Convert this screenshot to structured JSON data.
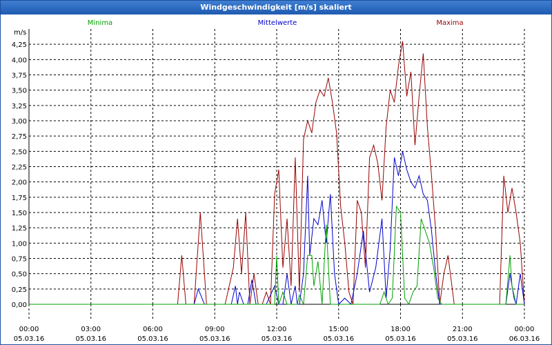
{
  "window": {
    "title": "Windgeschwindigkeit [m/s] skaliert"
  },
  "chart_data": {
    "type": "line",
    "title": "Windgeschwindigkeit [m/s] skaliert",
    "ylabel": "m/s",
    "xlabel": "",
    "ylim": [
      0,
      4.5
    ],
    "xlim": [
      0,
      24
    ],
    "grid": true,
    "legend_placement": "top",
    "y_ticks": [
      0,
      0.25,
      0.5,
      0.75,
      1.0,
      1.25,
      1.5,
      1.75,
      2.0,
      2.25,
      2.5,
      2.75,
      3.0,
      3.25,
      3.5,
      3.75,
      4.0,
      4.25
    ],
    "y_tick_labels": [
      "0,00",
      "0,25",
      "0,50",
      "0,75",
      "1,00",
      "1,25",
      "1,50",
      "1,75",
      "2,00",
      "2,25",
      "2,50",
      "2,75",
      "3,00",
      "3,25",
      "3,50",
      "3,75",
      "4,00",
      "4,25"
    ],
    "x_ticks": [
      {
        "time": "00:00",
        "date": "05.03.16"
      },
      {
        "time": "03:00",
        "date": "05.03.16"
      },
      {
        "time": "06:00",
        "date": "05.03.16"
      },
      {
        "time": "09:00",
        "date": "05.03.16"
      },
      {
        "time": "12:00",
        "date": "05.03.16"
      },
      {
        "time": "15:00",
        "date": "05.03.16"
      },
      {
        "time": "18:00",
        "date": "05.03.16"
      },
      {
        "time": "21:00",
        "date": "05.03.16"
      },
      {
        "time": "00:00",
        "date": "06.03.16"
      }
    ],
    "series": [
      {
        "name": "Minima",
        "color": "#00a000",
        "x": [
          0,
          11.9,
          12.0,
          12.1,
          12.3,
          12.5,
          12.7,
          13.0,
          13.1,
          13.3,
          13.5,
          13.7,
          13.8,
          14.0,
          14.2,
          14.4,
          14.6,
          14.8,
          15.0,
          15.5,
          16.0,
          16.5,
          17.0,
          17.2,
          17.4,
          17.6,
          17.8,
          18.0,
          18.2,
          18.4,
          18.6,
          18.8,
          19.0,
          19.2,
          19.4,
          19.6,
          19.8,
          20.0,
          23.1,
          23.3,
          23.4,
          23.6,
          23.8,
          24.0
        ],
        "y": [
          0,
          0,
          0.8,
          0,
          0.2,
          0,
          0,
          0,
          0.15,
          0,
          0.8,
          0.8,
          0.3,
          0.7,
          0,
          1.3,
          0,
          0,
          0,
          0,
          0,
          0,
          0,
          0.2,
          0,
          0.1,
          1.6,
          1.5,
          0.1,
          0,
          0.2,
          0.3,
          1.4,
          1.2,
          1.0,
          0.6,
          0.1,
          0,
          0,
          0.8,
          0.3,
          0,
          0,
          0
        ]
      },
      {
        "name": "Mittelwerte",
        "color": "#0000cc",
        "x": [
          0,
          7.5,
          7.6,
          7.8,
          8.0,
          8.2,
          8.5,
          9.6,
          9.8,
          10.0,
          10.1,
          10.2,
          10.4,
          10.6,
          10.8,
          11.0,
          11.2,
          11.3,
          11.5,
          11.7,
          11.9,
          12.1,
          12.3,
          12.5,
          12.7,
          12.9,
          13.0,
          13.1,
          13.3,
          13.5,
          13.6,
          13.8,
          14.0,
          14.2,
          14.4,
          14.6,
          14.8,
          15.0,
          15.3,
          15.6,
          15.9,
          16.2,
          16.5,
          16.8,
          17.1,
          17.3,
          17.5,
          17.7,
          17.9,
          18.1,
          18.3,
          18.5,
          18.7,
          18.9,
          19.1,
          19.3,
          19.5,
          19.7,
          19.9,
          20.1,
          20.3,
          20.5,
          20.7,
          21.0,
          22.5,
          23.1,
          23.3,
          23.5,
          23.6,
          23.8,
          24.0
        ],
        "y": [
          0,
          0,
          0,
          0,
          0,
          0.25,
          0,
          0,
          0,
          0.3,
          0,
          0.2,
          0,
          0,
          0.4,
          0,
          0,
          0,
          0,
          0.15,
          0.3,
          0,
          0,
          0.5,
          0,
          0.3,
          0,
          0,
          0.5,
          2.1,
          0.8,
          1.4,
          1.3,
          1.7,
          1.0,
          1.8,
          0.5,
          0,
          0.1,
          0,
          0.5,
          1.2,
          0.2,
          0.6,
          1.4,
          0.1,
          0.9,
          2.4,
          2.1,
          2.5,
          2.2,
          2.0,
          1.9,
          2.1,
          1.8,
          1.7,
          1.2,
          0.5,
          0,
          0,
          0,
          0,
          0,
          0,
          0,
          0,
          0.5,
          0.1,
          0,
          0.5,
          0
        ]
      },
      {
        "name": "Maxima",
        "color": "#990000",
        "x": [
          0,
          7.2,
          7.4,
          7.6,
          8.0,
          8.3,
          8.6,
          9.0,
          9.5,
          9.9,
          10.1,
          10.3,
          10.5,
          10.7,
          10.9,
          11.1,
          11.3,
          11.5,
          11.7,
          11.9,
          12.1,
          12.3,
          12.5,
          12.7,
          12.9,
          13.1,
          13.3,
          13.5,
          13.7,
          13.9,
          14.1,
          14.3,
          14.5,
          14.7,
          14.9,
          15.1,
          15.3,
          15.5,
          15.7,
          15.9,
          16.1,
          16.3,
          16.5,
          16.7,
          16.9,
          17.1,
          17.3,
          17.5,
          17.7,
          17.9,
          18.1,
          18.3,
          18.5,
          18.7,
          18.9,
          19.1,
          19.3,
          19.5,
          19.7,
          19.9,
          20.1,
          20.3,
          20.6,
          21.0,
          22.5,
          22.8,
          23.0,
          23.2,
          23.4,
          23.6,
          23.8,
          24.0
        ],
        "y": [
          0,
          0,
          0.8,
          0,
          0,
          1.5,
          0,
          0,
          0,
          0.6,
          1.4,
          0.5,
          1.5,
          0,
          0.5,
          0,
          0,
          0.2,
          0,
          1.8,
          2.2,
          0.6,
          1.4,
          0.3,
          2.4,
          0.2,
          2.7,
          3.0,
          2.8,
          3.3,
          3.5,
          3.4,
          3.7,
          3.3,
          2.8,
          1.6,
          1.0,
          0.2,
          0,
          1.7,
          1.5,
          0.6,
          2.4,
          2.6,
          2.3,
          1.7,
          2.9,
          3.5,
          3.3,
          3.9,
          4.3,
          3.4,
          3.8,
          2.6,
          3.4,
          4.1,
          2.9,
          2.1,
          1.2,
          0,
          0.5,
          0.8,
          0,
          0,
          0,
          0,
          2.1,
          1.5,
          1.9,
          1.5,
          1.0,
          0
        ]
      }
    ]
  }
}
